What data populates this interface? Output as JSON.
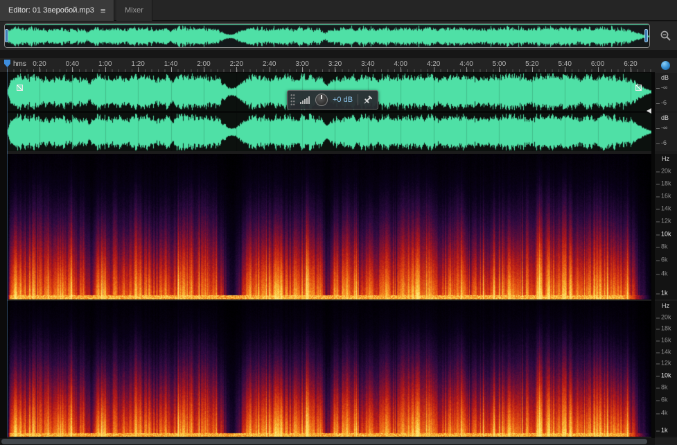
{
  "tabs": [
    {
      "label": "Editor: 01 Зверобой.mp3"
    },
    {
      "label": "Mixer"
    }
  ],
  "icons": {
    "panel_menu": "≡"
  },
  "timeline": {
    "unit_label": "hms",
    "ticks": [
      "0:20",
      "0:40",
      "1:00",
      "1:20",
      "1:40",
      "2:00",
      "2:20",
      "2:40",
      "3:00",
      "3:20",
      "3:40",
      "4:00",
      "4:20",
      "4:40",
      "5:00",
      "5:20",
      "5:40",
      "6:00",
      "6:20"
    ]
  },
  "hud": {
    "gain_value": "+0 dB"
  },
  "scales": {
    "db_unit": "dB",
    "db_ticks": [
      "-∞",
      "-6"
    ],
    "hz_unit": "Hz",
    "hz_ticks": [
      "20k",
      "18k",
      "16k",
      "14k",
      "12k",
      "10k",
      "8k",
      "6k",
      "4k",
      "1k"
    ],
    "hz_emphasized": [
      "10k",
      "1k"
    ]
  },
  "colors": {
    "waveform": "#4fe0a6",
    "playhead": "#3e8ede",
    "hud_value": "#8fc6ee"
  }
}
